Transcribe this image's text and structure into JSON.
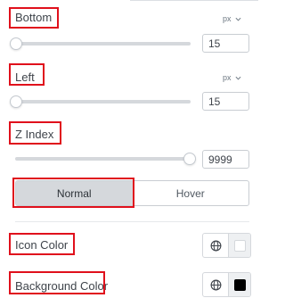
{
  "bottom": {
    "label": "Bottom",
    "unit": "px",
    "value": "15",
    "level": 0
  },
  "left": {
    "label": "Left",
    "unit": "px",
    "value": "15",
    "level": 0
  },
  "z_index": {
    "label": "Z Index",
    "value": "9999",
    "level": 1
  },
  "state_tabs": {
    "normal": "Normal",
    "hover": "Hover",
    "active": "normal"
  },
  "icon_color": {
    "label": "Icon Color",
    "swatch_color": "#ffffff",
    "global_icon": "globe-icon"
  },
  "background_color": {
    "label": "Background Color",
    "swatch_color": "#000000",
    "global_icon": "globe-icon"
  },
  "colors": {
    "highlight": "#e0101c",
    "track": "#d5d8dc",
    "active_tab": "#d5d8dc"
  }
}
